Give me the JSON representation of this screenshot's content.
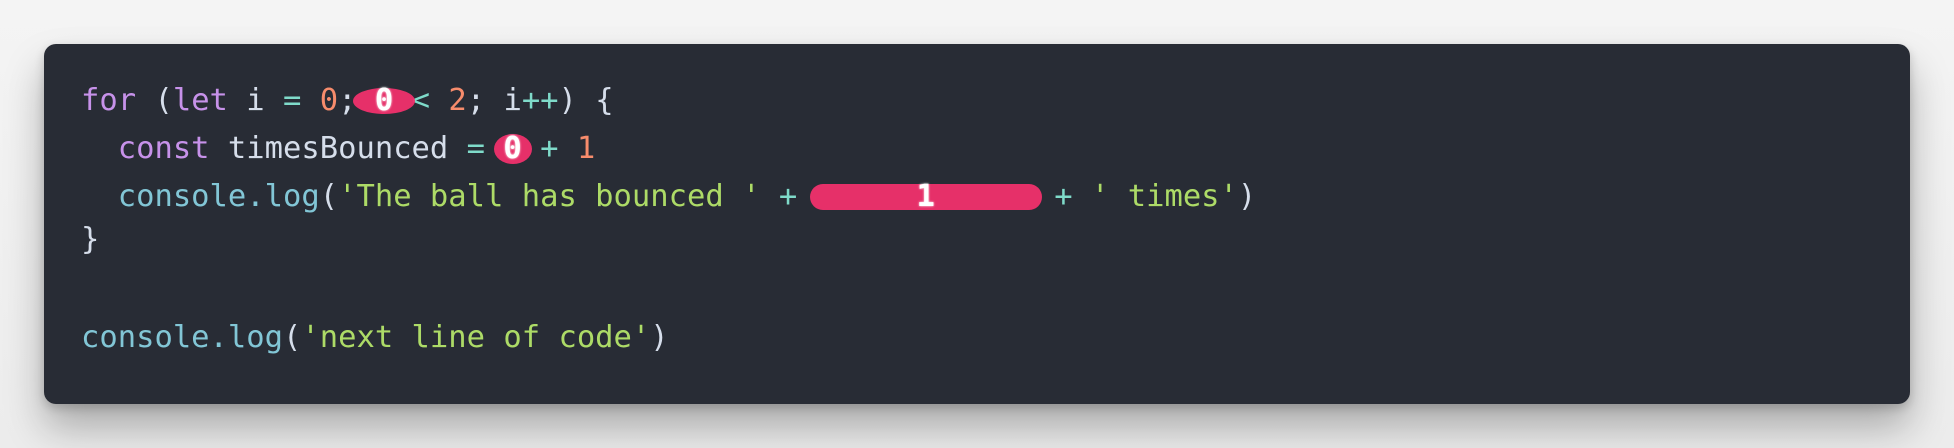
{
  "code": {
    "line1": {
      "kw_for": "for",
      "paren_open": " (",
      "kw_let": "let",
      "var_i": " i ",
      "op_eq": "=",
      "num_zero": " 0",
      "semi1": "; ",
      "annot_value": "0",
      "op_lt": " < ",
      "num_two": "2",
      "semi2": "; ",
      "var_i2": "i",
      "op_inc": "++",
      "tail": ") {"
    },
    "line2": {
      "indent": "  ",
      "kw_const": "const",
      "name": " timesBounced ",
      "op_eq": "=",
      "annot_value": "0",
      "op_plus": " + ",
      "num_one": "1"
    },
    "line3": {
      "indent": "  ",
      "fn": "console.log",
      "paren_open": "(",
      "str_open": "'The ball has bounced '",
      "op_plus1": " + ",
      "annot_value": "1",
      "op_plus2": " + ",
      "str_close": "' times'",
      "paren_close": ")"
    },
    "line4": {
      "brace": "}"
    },
    "line5": {
      "fn": "console.log",
      "paren_open": "(",
      "str": "'next line of code'",
      "paren_close": ")"
    }
  },
  "colors": {
    "background": "#282c35",
    "keyword": "#c792ea",
    "operator": "#7fdbca",
    "number": "#f78c6c",
    "function": "#82c6d6",
    "string": "#addb67",
    "annotation": "#f0306d"
  }
}
